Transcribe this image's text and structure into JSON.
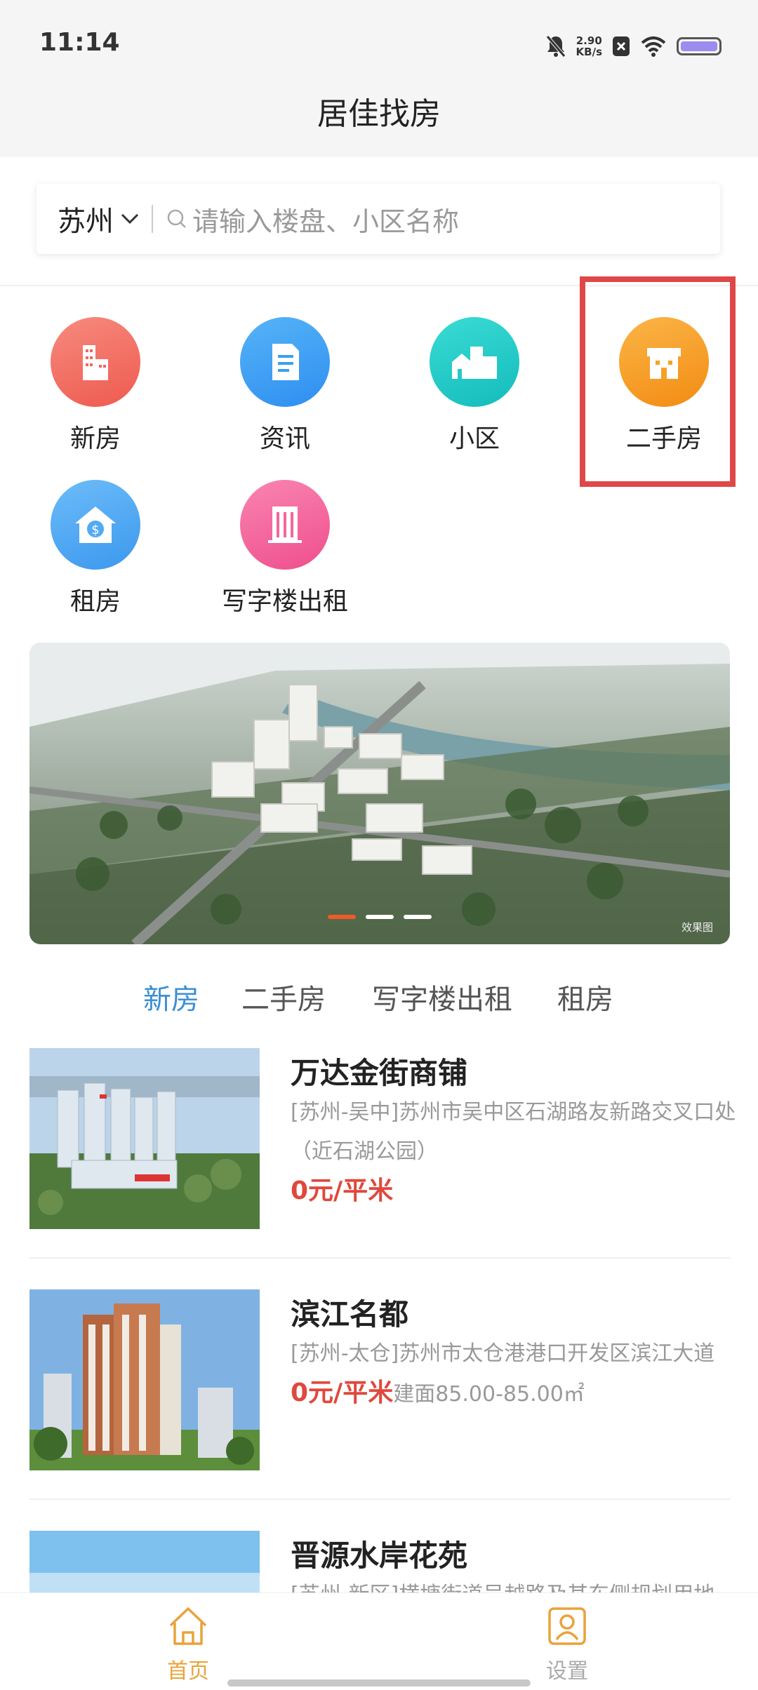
{
  "status_bar": {
    "time": "11:14",
    "net_speed_value": "2.90",
    "net_speed_unit": "KB/s"
  },
  "app": {
    "title": "居佳找房"
  },
  "search": {
    "city": "苏州",
    "placeholder": "请输入楼盘、小区名称"
  },
  "categories": [
    {
      "label": "新房",
      "icon": "building-icon",
      "color": "#f0665a"
    },
    {
      "label": "资讯",
      "icon": "document-icon",
      "color": "#3aa0f0"
    },
    {
      "label": "小区",
      "icon": "community-icon",
      "color": "#22c9c9"
    },
    {
      "label": "二手房",
      "icon": "house-icon",
      "color": "#f7a128"
    },
    {
      "label": "租房",
      "icon": "rent-house-dollar-icon",
      "color": "#52aaf5"
    },
    {
      "label": "写字楼出租",
      "icon": "office-building-icon",
      "color": "#f5669c"
    }
  ],
  "banner": {
    "watermark": "效果图",
    "active_slide": 1,
    "slide_count": 3
  },
  "tabs": [
    {
      "label": "新房",
      "active": true
    },
    {
      "label": "二手房",
      "active": false
    },
    {
      "label": "写字楼出租",
      "active": false
    },
    {
      "label": "租房",
      "active": false
    }
  ],
  "listings": [
    {
      "name": "万达金街商铺",
      "address": "[苏州-吴中]苏州市吴中区石湖路友新路交叉口处（近石湖公园）",
      "price": "0元/平米",
      "area": ""
    },
    {
      "name": "滨江名都",
      "address": "[苏州-太仓]苏州市太仓港港口开发区滨江大道",
      "price": "0元/平米",
      "area": "建面85.00-85.00㎡"
    },
    {
      "name": "晋源水岸花苑",
      "address": "[苏州-新区]横塘街道吴越路及其东侧规划用地",
      "price": "",
      "area": ""
    }
  ],
  "bottom_nav": {
    "home": "首页",
    "settings": "设置",
    "active_color": "#e8a33a"
  }
}
